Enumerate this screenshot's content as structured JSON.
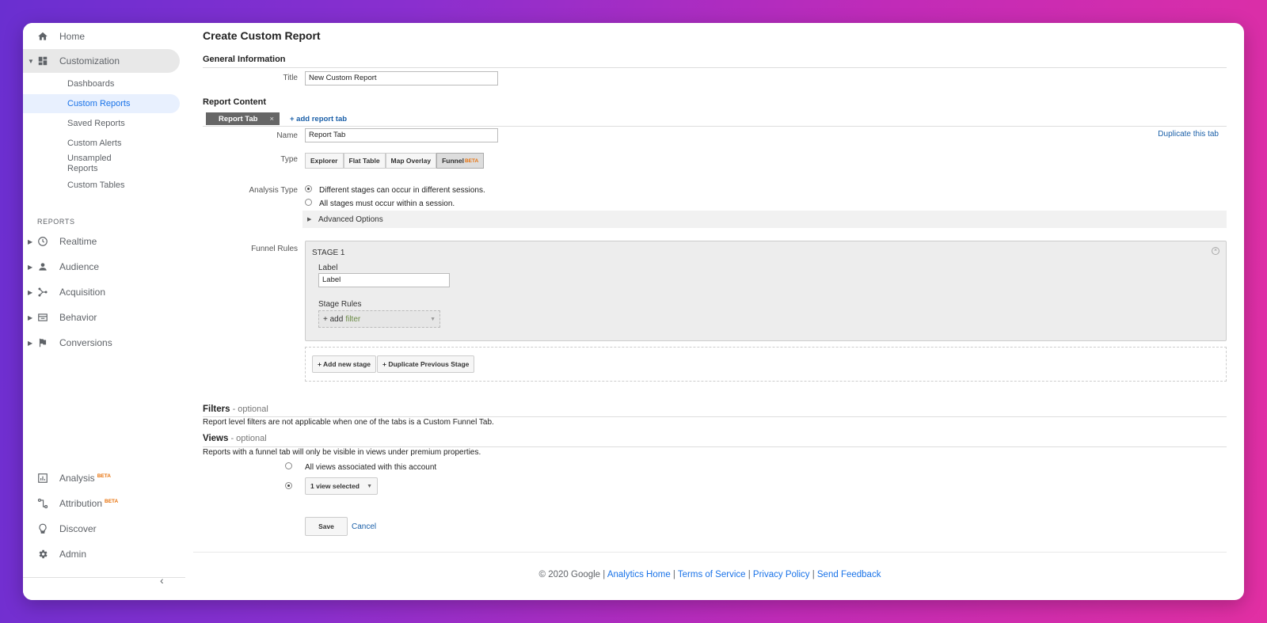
{
  "sidebar": {
    "home": "Home",
    "customization": "Customization",
    "sub_items": [
      "Dashboards",
      "Custom Reports",
      "Saved Reports",
      "Custom Alerts",
      "Unsampled Reports",
      "Custom Tables"
    ],
    "reports_header": "REPORTS",
    "reports": [
      "Realtime",
      "Audience",
      "Acquisition",
      "Behavior",
      "Conversions"
    ],
    "bottom": {
      "analysis": "Analysis",
      "attribution": "Attribution",
      "discover": "Discover",
      "admin": "Admin",
      "beta": "BETA"
    }
  },
  "main": {
    "title": "Create Custom Report",
    "general_info": "General Information",
    "title_label": "Title",
    "title_value": "New Custom Report",
    "report_content": "Report Content",
    "tab_label": "Report Tab",
    "tab_close": "×",
    "add_tab": "+ add report tab",
    "name_label": "Name",
    "name_value": "Report Tab",
    "duplicate_tab": "Duplicate this tab",
    "type_label": "Type",
    "types": [
      "Explorer",
      "Flat Table",
      "Map Overlay",
      "Funnel"
    ],
    "type_beta": "BETA",
    "analysis_type_label": "Analysis Type",
    "analysis_options": [
      "Different stages can occur in different sessions.",
      "All stages must occur within a session."
    ],
    "advanced_options": "Advanced Options",
    "funnel_rules_label": "Funnel Rules",
    "stage_title": "STAGE 1",
    "stage_label_caption": "Label",
    "stage_label_value": "Label",
    "stage_rules": "Stage Rules",
    "add_text": "+ add",
    "filter_text": "filter",
    "add_new_stage": "+ Add new stage",
    "duplicate_prev_stage": "+ Duplicate Previous Stage",
    "filters_title": "Filters",
    "optional": " - optional",
    "filters_text": "Report level filters are not applicable when one of the tabs is a Custom Funnel Tab.",
    "views_title": "Views",
    "views_text": "Reports with a funnel tab will only be visible in views under premium properties.",
    "views_all": "All views associated with this account",
    "views_selected": "1 view selected",
    "save": "Save",
    "cancel": "Cancel"
  },
  "footer": {
    "copyright": "© 2020 Google",
    "links": [
      "Analytics Home",
      "Terms of Service",
      "Privacy Policy",
      "Send Feedback"
    ],
    "separator": " | "
  }
}
